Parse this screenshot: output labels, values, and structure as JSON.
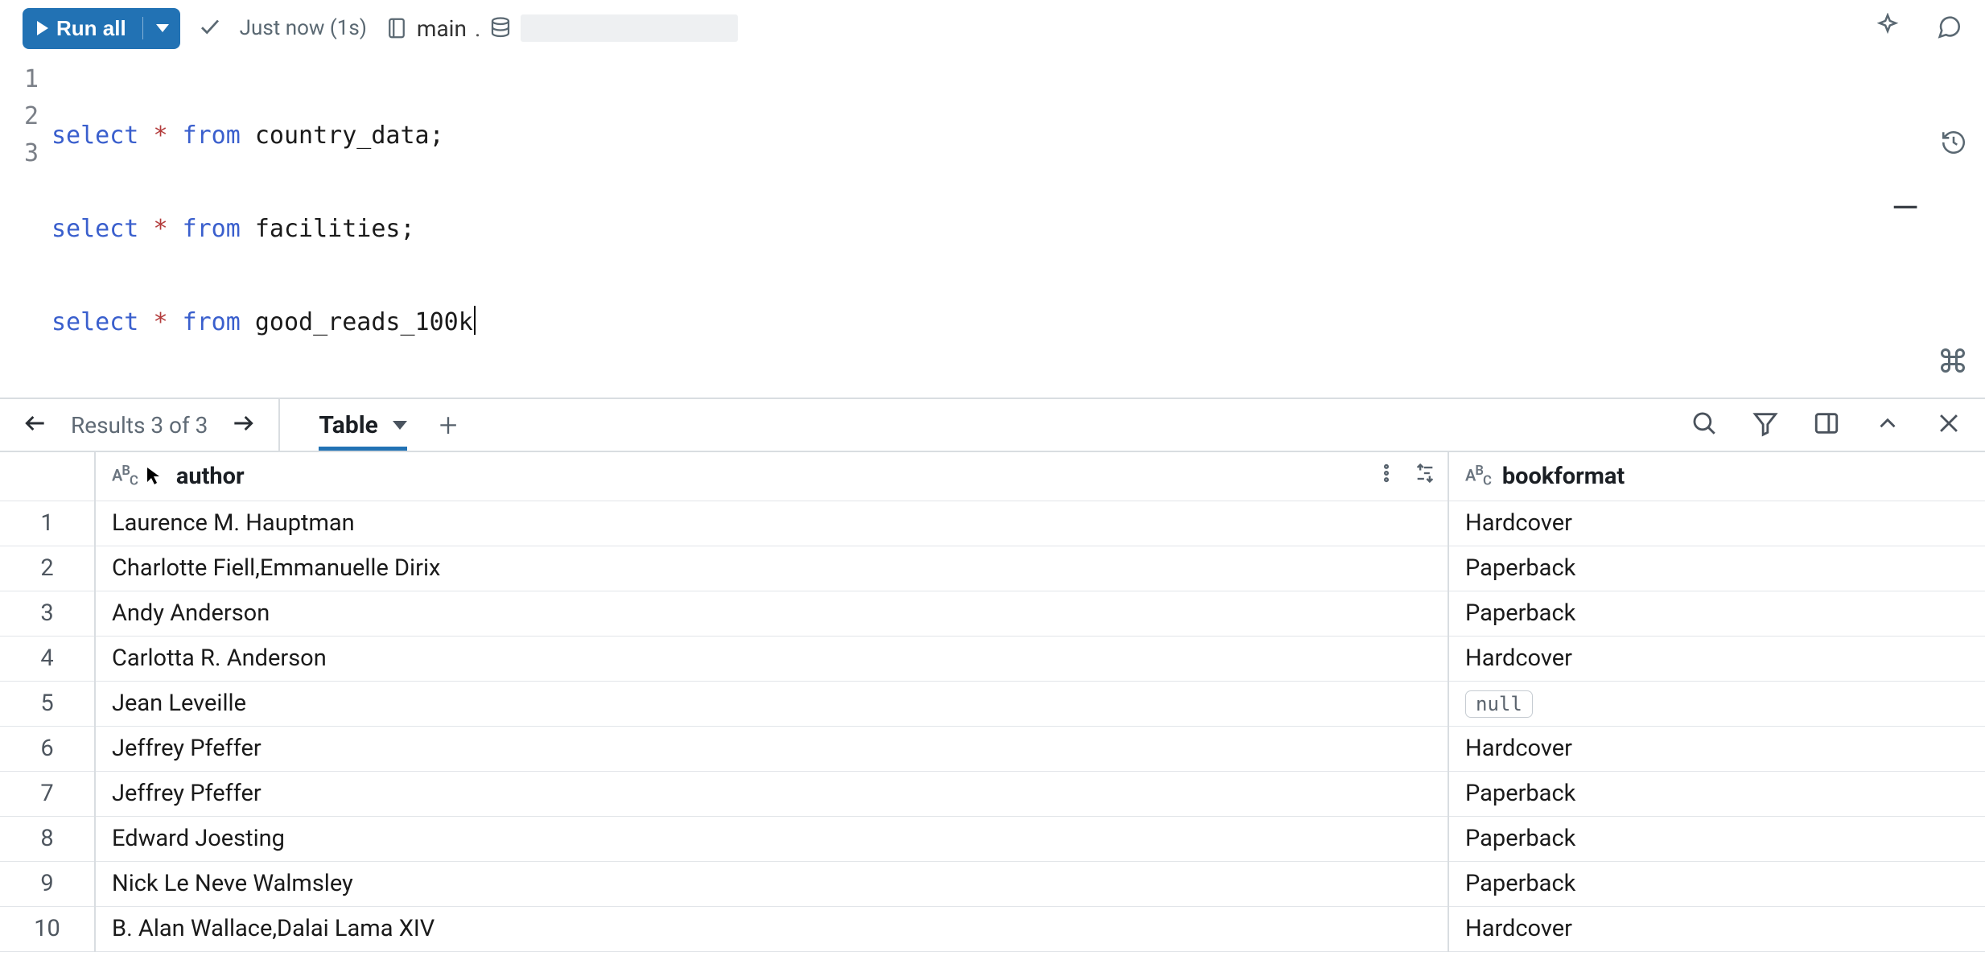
{
  "toolbar": {
    "run_label": "Run all",
    "status_text": "Just now (1s)",
    "catalog": "main",
    "sep": "."
  },
  "editor": {
    "lines": [
      {
        "n": "1",
        "kw1": "select",
        "op": "*",
        "kw2": "from",
        "ident": "country_data",
        "tail": ";"
      },
      {
        "n": "2",
        "kw1": "select",
        "op": "*",
        "kw2": "from",
        "ident": "facilities",
        "tail": ";"
      },
      {
        "n": "3",
        "kw1": "select",
        "op": "*",
        "kw2": "from",
        "ident": "good_reads_100k",
        "tail": ""
      }
    ]
  },
  "results": {
    "nav_label": "Results 3 of 3",
    "tab_label": "Table",
    "add_label": "+"
  },
  "table": {
    "columns": {
      "c1": "author",
      "c2": "bookformat"
    },
    "null_label": "null",
    "rows": [
      {
        "n": "1",
        "author": "Laurence M. Hauptman",
        "bookformat": "Hardcover"
      },
      {
        "n": "2",
        "author": "Charlotte Fiell,Emmanuelle Dirix",
        "bookformat": "Paperback"
      },
      {
        "n": "3",
        "author": "Andy Anderson",
        "bookformat": "Paperback"
      },
      {
        "n": "4",
        "author": "Carlotta R. Anderson",
        "bookformat": "Hardcover"
      },
      {
        "n": "5",
        "author": "Jean Leveille",
        "bookformat": null
      },
      {
        "n": "6",
        "author": "Jeffrey Pfeffer",
        "bookformat": "Hardcover"
      },
      {
        "n": "7",
        "author": "Jeffrey Pfeffer",
        "bookformat": "Paperback"
      },
      {
        "n": "8",
        "author": "Edward Joesting",
        "bookformat": "Paperback"
      },
      {
        "n": "9",
        "author": "Nick Le Neve Walmsley",
        "bookformat": "Paperback"
      },
      {
        "n": "10",
        "author": "B. Alan Wallace,Dalai Lama XIV",
        "bookformat": "Hardcover"
      }
    ]
  }
}
